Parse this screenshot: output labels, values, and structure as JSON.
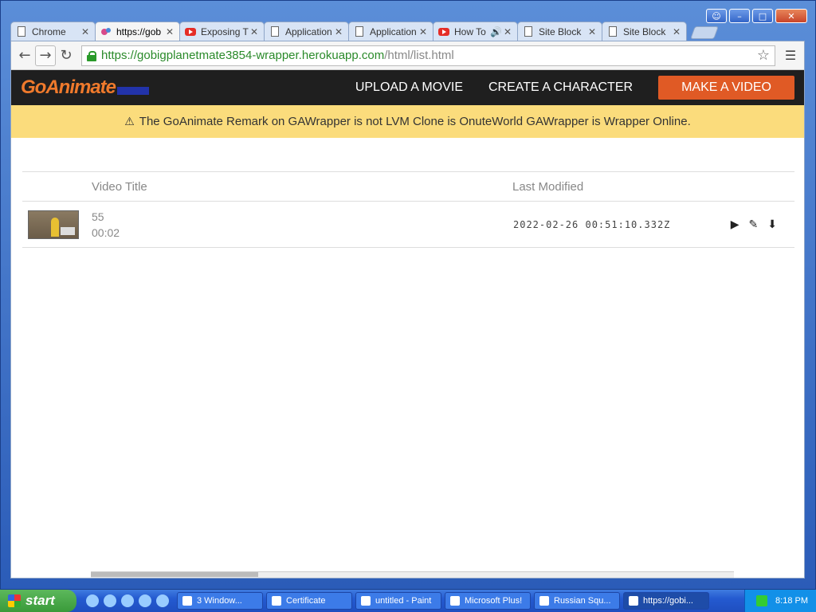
{
  "window": {
    "caption_buttons": [
      "user",
      "minimize",
      "maximize",
      "close"
    ]
  },
  "tabs": [
    {
      "label": "Chrome",
      "icon": "doc-icon"
    },
    {
      "label": "https://gob",
      "icon": "puzzle-icon",
      "active": true
    },
    {
      "label": "Exposing T",
      "icon": "youtube-icon"
    },
    {
      "label": "Application",
      "icon": "doc-icon"
    },
    {
      "label": "Application",
      "icon": "doc-icon"
    },
    {
      "label": "How To",
      "icon": "youtube-icon"
    },
    {
      "label": "Site Block",
      "icon": "doc-icon"
    },
    {
      "label": "Site Block",
      "icon": "doc-icon"
    }
  ],
  "omnibox": {
    "scheme": "https://",
    "host": "gobigplanetmate3854-wrapper.herokuapp.com",
    "path": "/html/list.html"
  },
  "site_nav": {
    "logo": "GoAnimate",
    "links": [
      "UPLOAD A MOVIE",
      "CREATE A CHARACTER"
    ],
    "cta": "MAKE A VIDEO"
  },
  "notice": "The GoAnimate Remark on GAWrapper is not LVM Clone is OnuteWorld GAWrapper is Wrapper Online.",
  "table": {
    "headers": {
      "title": "Video Title",
      "modified": "Last Modified"
    },
    "rows": [
      {
        "title": "55",
        "duration": "00:02",
        "modified": "2022-02-26 00:51:10.332Z"
      }
    ]
  },
  "taskbar": {
    "start": "start",
    "tasks": [
      {
        "label": "3 Window..."
      },
      {
        "label": "Certificate"
      },
      {
        "label": "untitled - Paint"
      },
      {
        "label": "Microsoft Plus!"
      },
      {
        "label": "Russian Squ..."
      },
      {
        "label": "https://gobi...",
        "active": true
      }
    ],
    "clock": "8:18 PM"
  }
}
